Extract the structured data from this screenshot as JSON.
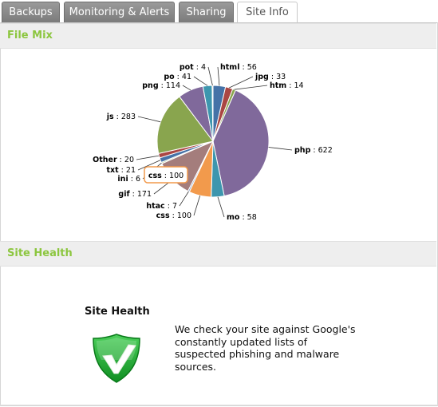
{
  "tabs": [
    {
      "label": "Backups",
      "active": false
    },
    {
      "label": "Monitoring & Alerts",
      "active": false
    },
    {
      "label": "Sharing",
      "active": false
    },
    {
      "label": "Site Info",
      "active": true
    }
  ],
  "file_mix": {
    "title": "File Mix",
    "tooltip": {
      "name": "css",
      "value": "100"
    }
  },
  "chart_data": {
    "type": "pie",
    "title": "",
    "slices": [
      {
        "name": "html",
        "value": 56,
        "color": "#4572a7"
      },
      {
        "name": "jpg",
        "value": 33,
        "color": "#aa4643"
      },
      {
        "name": "htm",
        "value": 14,
        "color": "#89a54e"
      },
      {
        "name": "php",
        "value": 622,
        "color": "#80699b"
      },
      {
        "name": "mo",
        "value": 58,
        "color": "#3d96ae"
      },
      {
        "name": "css",
        "value": 100,
        "color": "#f29a4c"
      },
      {
        "name": "htac",
        "value": 7,
        "color": "#92a8cd"
      },
      {
        "name": "gif",
        "value": 171,
        "color": "#a47d7c"
      },
      {
        "name": "ini",
        "value": 6,
        "color": "#b5ca92"
      },
      {
        "name": "txt",
        "value": 21,
        "color": "#4572a7"
      },
      {
        "name": "Other",
        "value": 20,
        "color": "#aa4643"
      },
      {
        "name": "js",
        "value": 283,
        "color": "#89a54e"
      },
      {
        "name": "png",
        "value": 114,
        "color": "#80699b"
      },
      {
        "name": "po",
        "value": 41,
        "color": "#3d96ae"
      },
      {
        "name": "pot",
        "value": 4,
        "color": "#f29a4c"
      }
    ]
  },
  "site_health": {
    "section_title": "Site Health",
    "heading": "Site Health",
    "description": "We check your site against Google's constantly updated lists of suspected phishing and malware sources.",
    "icon": "shield-check-icon",
    "accent_color": "#8cc63f"
  }
}
